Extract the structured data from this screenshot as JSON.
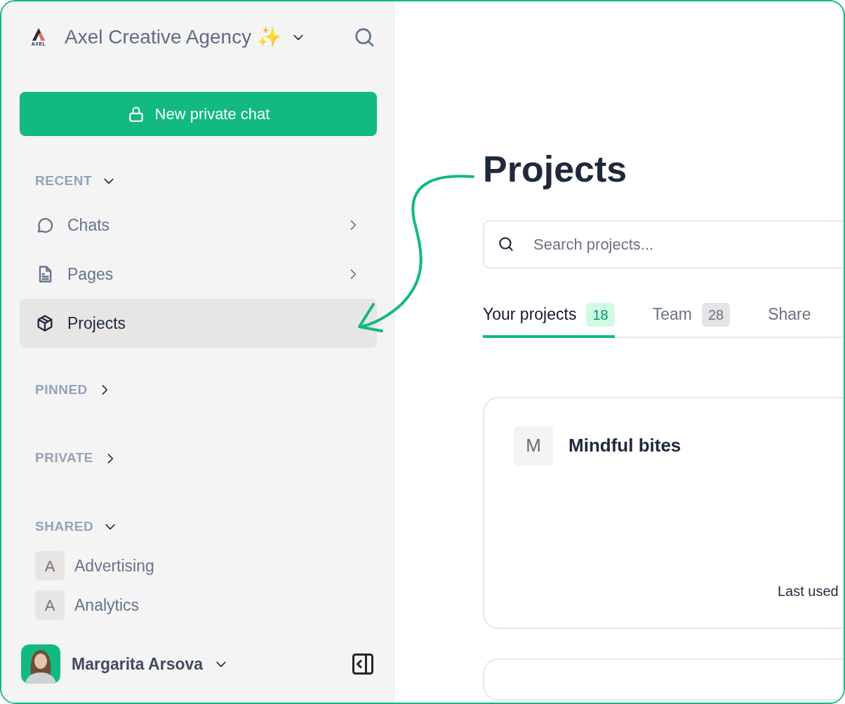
{
  "workspace": {
    "logo_text": "AXEL",
    "name": "Axel Creative Agency ✨"
  },
  "new_chat_button": {
    "label": "New private chat"
  },
  "sections": [
    {
      "label": "RECENT",
      "expanded": true,
      "items": [
        {
          "kind": "nav",
          "label": "Chats",
          "expandable": true,
          "selected": false
        },
        {
          "kind": "nav",
          "label": "Pages",
          "expandable": true,
          "selected": false
        },
        {
          "kind": "nav",
          "label": "Projects",
          "expandable": false,
          "selected": true
        }
      ]
    },
    {
      "label": "PINNED",
      "expanded": false
    },
    {
      "label": "PRIVATE",
      "expanded": false
    },
    {
      "label": "SHARED",
      "expanded": true,
      "items": [
        {
          "kind": "space",
          "initial": "A",
          "label": "Advertising"
        },
        {
          "kind": "space",
          "initial": "A",
          "label": "Analytics"
        }
      ]
    }
  ],
  "user": {
    "name": "Margarita Arsova"
  },
  "main": {
    "title": "Projects",
    "search": {
      "placeholder": "Search projects..."
    },
    "tabs": [
      {
        "label": "Your projects",
        "count": "18",
        "selected": true
      },
      {
        "label": "Team",
        "count": "28",
        "selected": false
      },
      {
        "label": "Share",
        "selected": false
      }
    ],
    "projects": [
      {
        "kind": "full",
        "initial": "M",
        "name": "Mindful bites",
        "footer": "Last used"
      },
      {
        "kind": "partial"
      }
    ]
  }
}
